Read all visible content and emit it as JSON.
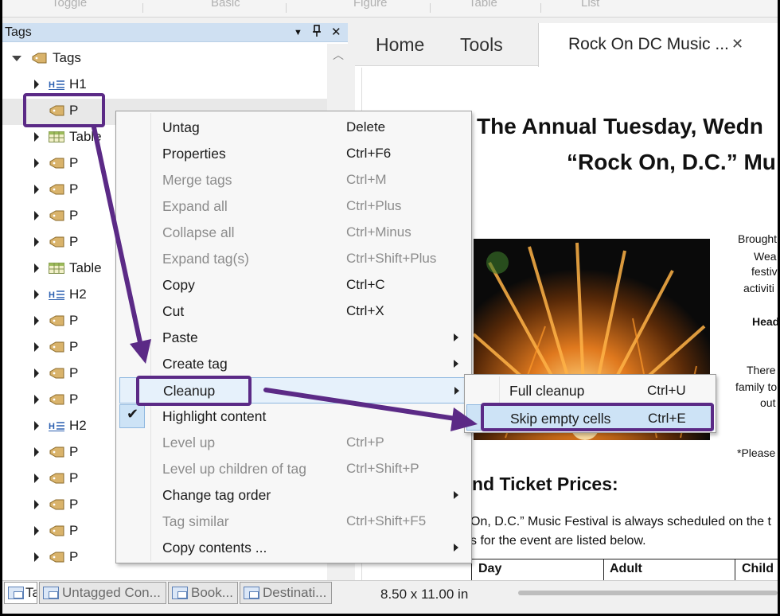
{
  "ribbon": {
    "tabs": [
      "Toggle",
      "Basic",
      "Figure",
      "Table",
      "List"
    ]
  },
  "tags_panel": {
    "title": "Tags",
    "menu_glyph": "▼",
    "pin_glyph": "📌",
    "close_glyph": "✕",
    "root_label": "Tags",
    "items": [
      {
        "label": "H1",
        "icon": "heading-icon",
        "expanded": false
      },
      {
        "label": "P",
        "icon": "tag-icon",
        "expanded": null
      },
      {
        "label": "Table",
        "icon": "table-icon",
        "expanded": false
      },
      {
        "label": "P",
        "icon": "tag-icon",
        "expanded": false
      },
      {
        "label": "P",
        "icon": "tag-icon",
        "expanded": false
      },
      {
        "label": "P",
        "icon": "tag-icon",
        "expanded": false
      },
      {
        "label": "P",
        "icon": "tag-icon",
        "expanded": false
      },
      {
        "label": "Table",
        "icon": "table-icon",
        "expanded": false
      },
      {
        "label": "H2",
        "icon": "heading-icon",
        "expanded": false
      },
      {
        "label": "P",
        "icon": "tag-icon",
        "expanded": false
      },
      {
        "label": "P",
        "icon": "tag-icon",
        "expanded": false
      },
      {
        "label": "P",
        "icon": "tag-icon",
        "expanded": false
      },
      {
        "label": "P",
        "icon": "tag-icon",
        "expanded": false
      },
      {
        "label": "H2",
        "icon": "heading-icon",
        "expanded": false
      },
      {
        "label": "P",
        "icon": "tag-icon",
        "expanded": false
      },
      {
        "label": "P",
        "icon": "tag-icon",
        "expanded": false
      },
      {
        "label": "P",
        "icon": "tag-icon",
        "expanded": false
      },
      {
        "label": "P",
        "icon": "tag-icon",
        "expanded": false
      },
      {
        "label": "P",
        "icon": "tag-icon",
        "expanded": false
      }
    ]
  },
  "bottom_bar": {
    "tabs": [
      "Tags...",
      "Untagged Con...",
      "Book...",
      "Destinati..."
    ],
    "page_size": "8.50 x 11.00 in"
  },
  "doc": {
    "nav_tabs": [
      "Home",
      "Tools"
    ],
    "file_tab": "Rock On DC Music ...",
    "close_glyph": "✕",
    "title_line1": "The Annual Tuesday, Wedn",
    "title_line2": "“Rock On, D.C.” Mu",
    "side_lines": [
      "Brought",
      "Wea",
      "festiv",
      "activiti",
      "Head",
      "There",
      "family to",
      "out",
      "*Please"
    ],
    "ticket_heading": "nd Ticket Prices:",
    "body_lines": [
      "On, D.C.” Music Festival is always scheduled on the t",
      "s for the event are listed below."
    ],
    "table_headers": [
      "Day",
      "Adult",
      "Child"
    ]
  },
  "context_menu": {
    "items": [
      {
        "label": "Untag",
        "shortcut": "Delete",
        "enabled": true,
        "submenu": false
      },
      {
        "label": "Properties",
        "shortcut": "Ctrl+F6",
        "enabled": true,
        "submenu": false
      },
      {
        "label": "Merge tags",
        "shortcut": "Ctrl+M",
        "enabled": false,
        "submenu": false
      },
      {
        "label": "Expand all",
        "shortcut": "Ctrl+Plus",
        "enabled": false,
        "submenu": false
      },
      {
        "label": "Collapse all",
        "shortcut": "Ctrl+Minus",
        "enabled": false,
        "submenu": false
      },
      {
        "label": "Expand tag(s)",
        "shortcut": "Ctrl+Shift+Plus",
        "enabled": false,
        "submenu": false
      },
      {
        "label": "Copy",
        "shortcut": "Ctrl+C",
        "enabled": true,
        "submenu": false
      },
      {
        "label": "Cut",
        "shortcut": "Ctrl+X",
        "enabled": true,
        "submenu": false
      },
      {
        "label": "Paste",
        "shortcut": "",
        "enabled": true,
        "submenu": true
      },
      {
        "label": "Create tag",
        "shortcut": "",
        "enabled": true,
        "submenu": true
      },
      {
        "label": "Cleanup",
        "shortcut": "",
        "enabled": true,
        "submenu": true,
        "highlighted": true
      },
      {
        "label": "Highlight content",
        "shortcut": "",
        "enabled": true,
        "submenu": false,
        "checked": true
      },
      {
        "label": "Level up",
        "shortcut": "Ctrl+P",
        "enabled": false,
        "submenu": false
      },
      {
        "label": "Level up children of tag",
        "shortcut": "Ctrl+Shift+P",
        "enabled": false,
        "submenu": false
      },
      {
        "label": "Change tag order",
        "shortcut": "",
        "enabled": true,
        "submenu": true
      },
      {
        "label": "Tag similar",
        "shortcut": "Ctrl+Shift+F5",
        "enabled": false,
        "submenu": false
      },
      {
        "label": "Copy contents ...",
        "shortcut": "",
        "enabled": true,
        "submenu": true
      }
    ]
  },
  "submenu": {
    "items": [
      {
        "label": "Full cleanup",
        "shortcut": "Ctrl+U"
      },
      {
        "label": "Skip empty cells",
        "shortcut": "Ctrl+E",
        "highlighted": true
      }
    ]
  },
  "colors": {
    "annotation": "#5b2a86",
    "menu_highlight": "#cde3f6",
    "header_blue": "#cfe0f2"
  }
}
